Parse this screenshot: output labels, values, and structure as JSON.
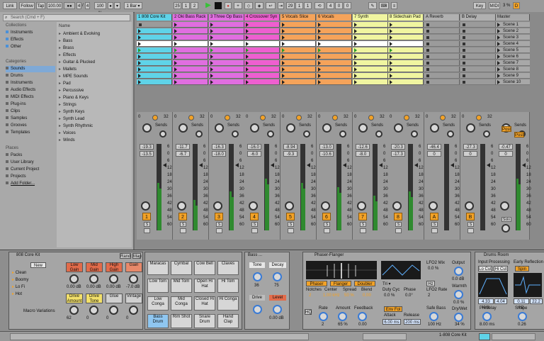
{
  "topbar": {
    "link": "Link",
    "follow": "Follow",
    "tap": "Tap",
    "tempo": "100.00",
    "time_sig_num": "4",
    "time_sig_den": "4",
    "zoom": "100 %",
    "quantize": "1 Bar",
    "pos": [
      "25",
      "1",
      "2"
    ],
    "loop_start": [
      "29",
      "1",
      "1"
    ],
    "loop_len": [
      "4",
      "0",
      "0"
    ],
    "key": "Key",
    "midi": "MIDI",
    "cpu": "3 %",
    "d_label": "D"
  },
  "browser": {
    "search_placeholder": "Search (Cmd + F)",
    "collections_header": "Collections",
    "collections": [
      "Instruments",
      "Effects",
      "Other"
    ],
    "categories_header": "Categories",
    "categories": [
      "Sounds",
      "Drums",
      "Instruments",
      "Audio Effects",
      "MIDI Effects",
      "Plug-ins",
      "Clips",
      "Samples",
      "Grooves",
      "Templates"
    ],
    "places_header": "Places",
    "places": [
      "Packs",
      "User Library",
      "Current Project",
      "Projects",
      "Add Folder..."
    ],
    "name_header": "Name",
    "list": [
      "Ambient & Evolving",
      "Bass",
      "Brass",
      "Effects",
      "Guitar & Plucked",
      "Mallets",
      "MPE Sounds",
      "Pad",
      "Percussive",
      "Piano & Keys",
      "Strings",
      "Synth Keys",
      "Synth Lead",
      "Synth Rhythmic",
      "Voices",
      "Winds"
    ]
  },
  "tracks": [
    {
      "name": "1 808 Core Kit",
      "color": "#5fd3e8",
      "num": "1",
      "vol": "-19.3",
      "vol2": "-13.5"
    },
    {
      "name": "2 Oki Bass Rack",
      "color": "#e06ee0",
      "num": "2",
      "vol": "-11.7",
      "vol2": "-6.7"
    },
    {
      "name": "3 Three Op Bass",
      "color": "#e06ee0",
      "num": "3",
      "vol": "-16.3",
      "vol2": "-18.0"
    },
    {
      "name": "4 Crossover Syn",
      "color": "#ee5fd0",
      "num": "4",
      "vol": "-16.0",
      "vol2": "-6.0"
    },
    {
      "name": "5 Vocals Slice",
      "color": "#f5a35a",
      "num": "5",
      "vol": "-8.94",
      "vol2": "-9.3"
    },
    {
      "name": "6 Vocals",
      "color": "#f5a35a",
      "num": "6",
      "vol": "-13.0",
      "vol2": "-10.6"
    },
    {
      "name": "7 Synth",
      "color": "#f0f5a0",
      "num": "7",
      "vol": "-12.6",
      "vol2": "-8.0"
    },
    {
      "name": "8 Sidechain Pad",
      "color": "#f0f5a0",
      "num": "8",
      "vol": "-20.3",
      "vol2": "-17.3"
    },
    {
      "name": "A Reverb",
      "color": "#b0b0b0",
      "num": "A",
      "vol": "-46.4",
      "vol2": "0"
    },
    {
      "name": "B Delay",
      "color": "#b0b0b0",
      "num": "B",
      "vol": "-27.3",
      "vol2": "0"
    }
  ],
  "master": {
    "name": "Master",
    "vol": "-0.47",
    "vol2": "0",
    "solo": "Solo",
    "post": "Post"
  },
  "scenes": [
    "Scene 1",
    "Scene 2",
    "Scene 3",
    "Scene 4",
    "Scene 5",
    "Scene 6",
    "Scene 7",
    "Scene 8",
    "Scene 9",
    "Scene 10"
  ],
  "mixer": {
    "sends": "Sends",
    "meter_ticks": [
      "6",
      "0",
      "6",
      "12",
      "18",
      "24",
      "30",
      "36",
      "42",
      "48",
      "54",
      "60"
    ],
    "strip_counts": [
      "0",
      "32"
    ],
    "s_label": "S",
    "solo_label": "Solo"
  },
  "devices": {
    "drum_rack": {
      "title": "808 Core Kit",
      "rand": "Rand",
      "map": "Map",
      "new": "New",
      "variations": [
        "Clean",
        "Boomy",
        "Lo Fi",
        "Hot"
      ],
      "macro_label": "Macro Variations",
      "macros": [
        {
          "name": "Low Gain",
          "val": "0.00 dB"
        },
        {
          "name": "Mid Gain",
          "val": "0.00 dB"
        },
        {
          "name": "High Gain",
          "val": "0.00 dB"
        },
        {
          "name": "Gain",
          "val": "-7.0 dB"
        },
        {
          "name": "Drive Amount",
          "val": "62"
        },
        {
          "name": "Drive Tone",
          "val": "0"
        },
        {
          "name": "Glue",
          "val": "0"
        },
        {
          "name": "Vintage",
          "val": "0"
        }
      ],
      "pads": [
        "Maracas",
        "Cymbal",
        "Cow Bell",
        "Claves",
        "Low Tom",
        "Mid Tom",
        "Open Hi Hat",
        "Hi Tom",
        "Low Conga",
        "Mid Conga",
        "Closed Hi Hat",
        "Hi Conga",
        "Bass Drum",
        "Rim Shot",
        "Snare Drum",
        "Hand Clap"
      ]
    },
    "bass": {
      "title": "Bass ...",
      "tone": "Tone",
      "decay": "Decay",
      "tone_val": "36",
      "decay_val": "75",
      "drive": "Drive",
      "level": "Level",
      "level_val": "0.00 dB"
    },
    "phaser": {
      "title": "Phaser-Flanger",
      "modes": [
        "Phaser",
        "Flanger",
        "Doubler"
      ],
      "notches_label": "Notches",
      "notches": "2",
      "center_label": "Center",
      "center": "1.00 kHz",
      "spread_label": "Spread",
      "spread": "50 %",
      "blend_label": "Blend",
      "blend": "0.00",
      "lfo_wave": "Tri",
      "duty_label": "Duty Cyc",
      "duty": "0.0 %",
      "phase_label": "Phase",
      "phase": "0.0°",
      "lfo2_mix_label": "LFO2 Mix",
      "lfo2_mix": "0.0 %",
      "hz": "Hz",
      "lfo2_rate_label": "LFO2 Rate",
      "lfo2_rate": "2",
      "safe_bass_label": "Safe Bass",
      "safe_bass": "100 Hz",
      "rate_label": "Rate",
      "rate": "2",
      "amount_label": "Amount",
      "amount": "65 %",
      "feedback_label": "Feedback",
      "feedback": "0.00",
      "env_fol": "Env Fol",
      "attack_label": "Attack",
      "attack": "6.00 ms",
      "release_label": "Release",
      "release": "200 ms",
      "output_label": "Output",
      "output": "0.0 dB",
      "warmth_label": "Warmth",
      "warmth": "0.0 %",
      "drywet_label": "Dry/Wet",
      "drywet": "34 %",
      "hq": "HQ"
    },
    "reverb": {
      "title": "Drums Room",
      "input_processing": "Input Processing",
      "early": "Early Reflection",
      "locut": "Lo Cut",
      "hicut": "Hi Cut",
      "spin": "Spin",
      "freq1": "4.33 kHz",
      "freq2": "4.04",
      "freq3": "0.11 Hz",
      "freq4": "22.2",
      "predelay_label": "Predelay",
      "predelay": "8.00 ms",
      "shape_label": "Shape",
      "shape": "0.26"
    }
  },
  "statusbar": {
    "track_name": "1-808 Core Kit"
  },
  "colors": {
    "accent_orange": "#f2a227",
    "play_green": "#36c236",
    "clip_cyan": "#5fd3e8",
    "clip_purple": "#e06ee0",
    "clip_orange": "#f5a35a",
    "clip_yellow": "#f0f5a0"
  }
}
